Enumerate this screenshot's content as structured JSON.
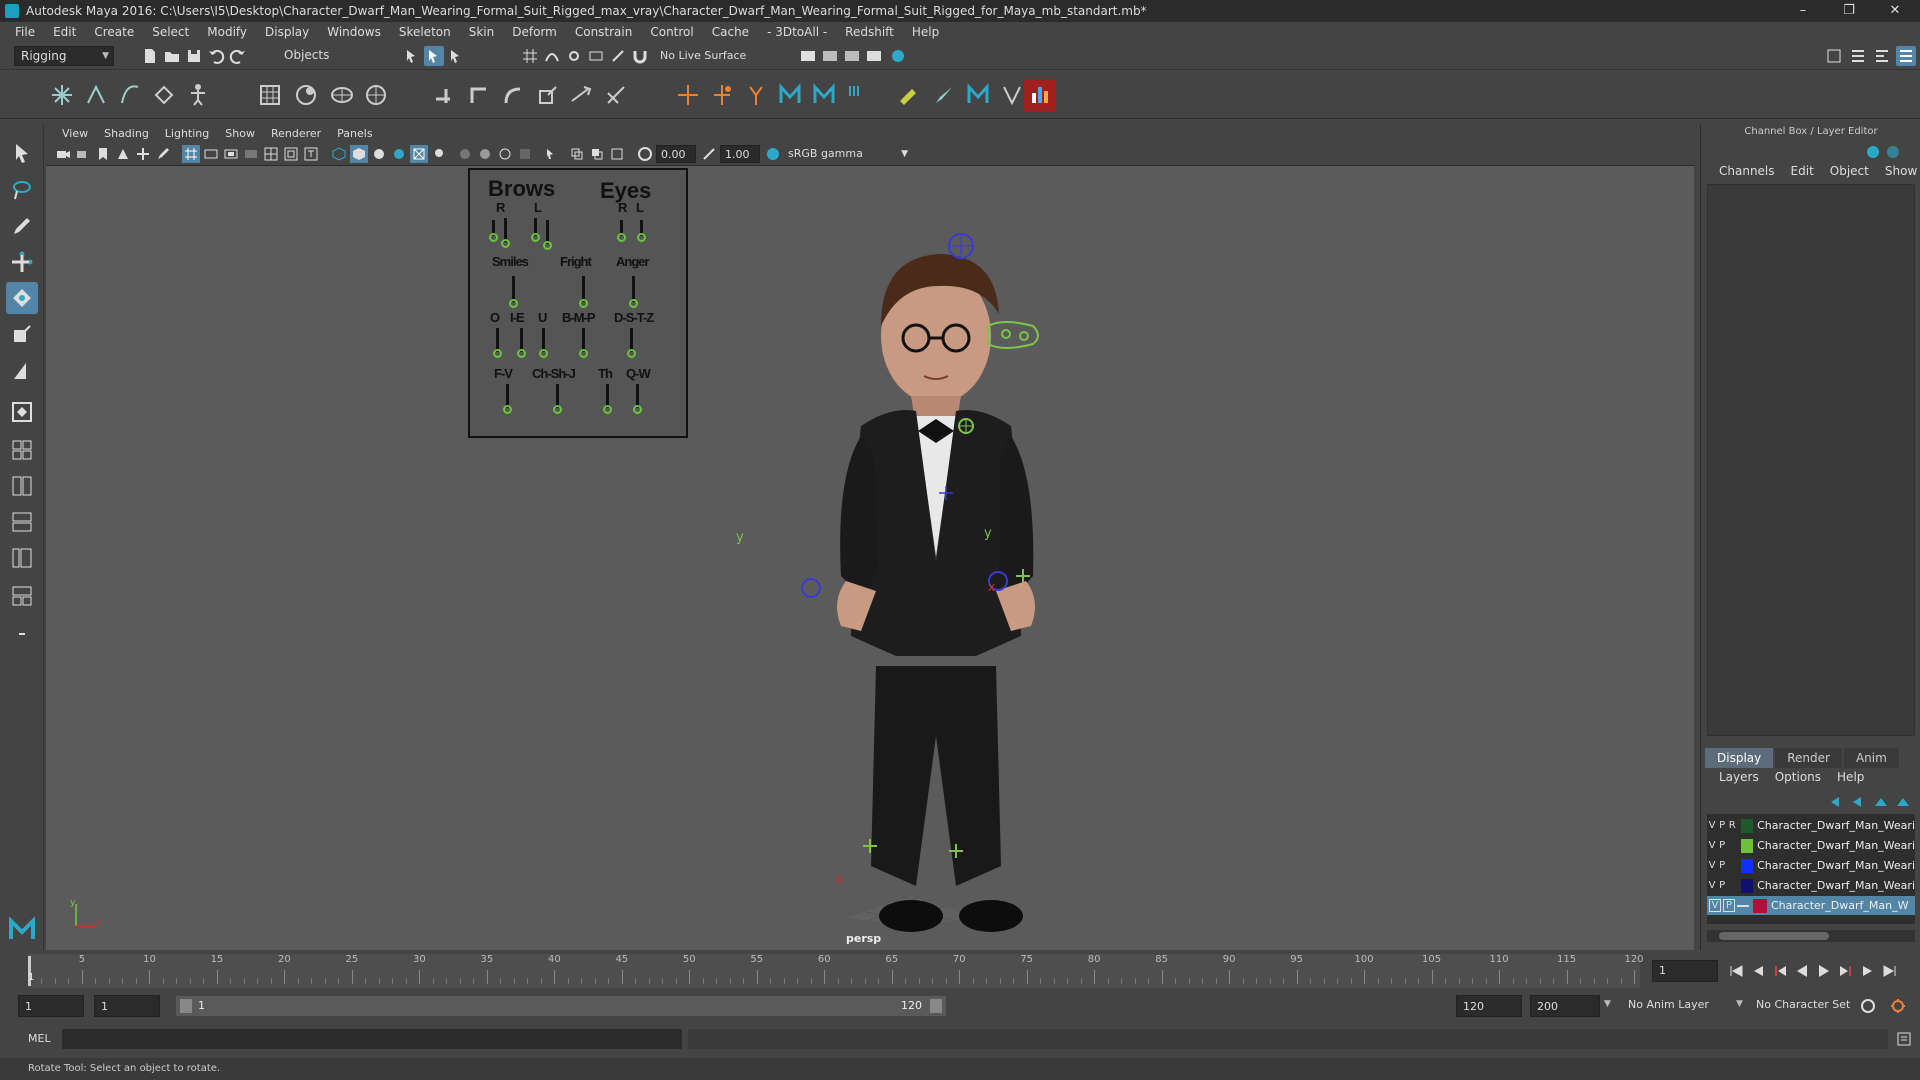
{
  "window": {
    "title": "Autodesk Maya 2016: C:\\Users\\I5\\Desktop\\Character_Dwarf_Man_Wearing_Formal_Suit_Rigged_max_vray\\Character_Dwarf_Man_Wearing_Formal_Suit_Rigged_for_Maya_mb_standart.mb*",
    "minimize": "–",
    "restore": "❐",
    "close": "✕"
  },
  "menubar": [
    "File",
    "Edit",
    "Create",
    "Select",
    "Modify",
    "Display",
    "Windows",
    "Skeleton",
    "Skin",
    "Deform",
    "Constrain",
    "Control",
    "Cache",
    "- 3DtoAll -",
    "Redshift",
    "Help"
  ],
  "statusline": {
    "mode": "Rigging",
    "selection_mode": "Objects",
    "live_surface": "No Live Surface"
  },
  "viewport": {
    "menu": [
      "View",
      "Shading",
      "Lighting",
      "Show",
      "Renderer",
      "Panels"
    ],
    "field_a": "0.00",
    "field_b": "1.00",
    "color_space": "sRGB gamma",
    "camera_label": "persp"
  },
  "facial_board": {
    "brows": "Brows",
    "eyes": "Eyes",
    "r1": "R",
    "l1": "L",
    "r2": "R",
    "l2": "L",
    "smiles": "Smiles",
    "fright": "Fright",
    "anger": "Anger",
    "o": "O",
    "ie": "I-E",
    "u": "U",
    "bmp": "B-M-P",
    "dstz": "D-S-T-Z",
    "fv": "F-V",
    "chshj": "Ch-Sh-J",
    "th": "Th",
    "qw": "Q-W"
  },
  "axis_labels": {
    "y1": "y",
    "y2": "y",
    "x1": "x",
    "x2": "x",
    "gx": "x",
    "gy": "y"
  },
  "channelbox": {
    "title": "Channel Box / Layer Editor",
    "menu": [
      "Channels",
      "Edit",
      "Object",
      "Show"
    ],
    "tabs": [
      "Display",
      "Render",
      "Anim"
    ],
    "layer_menu": [
      "Layers",
      "Options",
      "Help"
    ],
    "layers": [
      {
        "v": "V",
        "p": "P",
        "r": "R",
        "color": "#1f5a2a",
        "name": "Character_Dwarf_Man_Weari"
      },
      {
        "v": "V",
        "p": "P",
        "r": "",
        "color": "#6cc23a",
        "name": "Character_Dwarf_Man_Weari"
      },
      {
        "v": "V",
        "p": "P",
        "r": "",
        "color": "#1030ff",
        "name": "Character_Dwarf_Man_Weari"
      },
      {
        "v": "V",
        "p": "P",
        "r": "",
        "color": "#101070",
        "name": "Character_Dwarf_Man_Weari"
      },
      {
        "v": "V",
        "p": "P",
        "r": "",
        "color": "#b0103a",
        "name": "Character_Dwarf_Man_W"
      }
    ]
  },
  "timeline": {
    "ticks": [
      "5",
      "10",
      "15",
      "20",
      "25",
      "30",
      "35",
      "40",
      "45",
      "50",
      "55",
      "60",
      "65",
      "70",
      "75",
      "80",
      "85",
      "90",
      "95",
      "100",
      "105",
      "110",
      "115",
      "120"
    ],
    "start_marker": "1",
    "current_frame": "1"
  },
  "range": {
    "start": "1",
    "playback_start": "1",
    "range_start": "1",
    "range_end": "120",
    "end": "120",
    "max": "200",
    "anim_layer": "No Anim Layer",
    "character_set": "No Character Set"
  },
  "cmdline": {
    "lang": "MEL"
  },
  "helpline": {
    "text": "Rotate Tool: Select an object to rotate."
  }
}
